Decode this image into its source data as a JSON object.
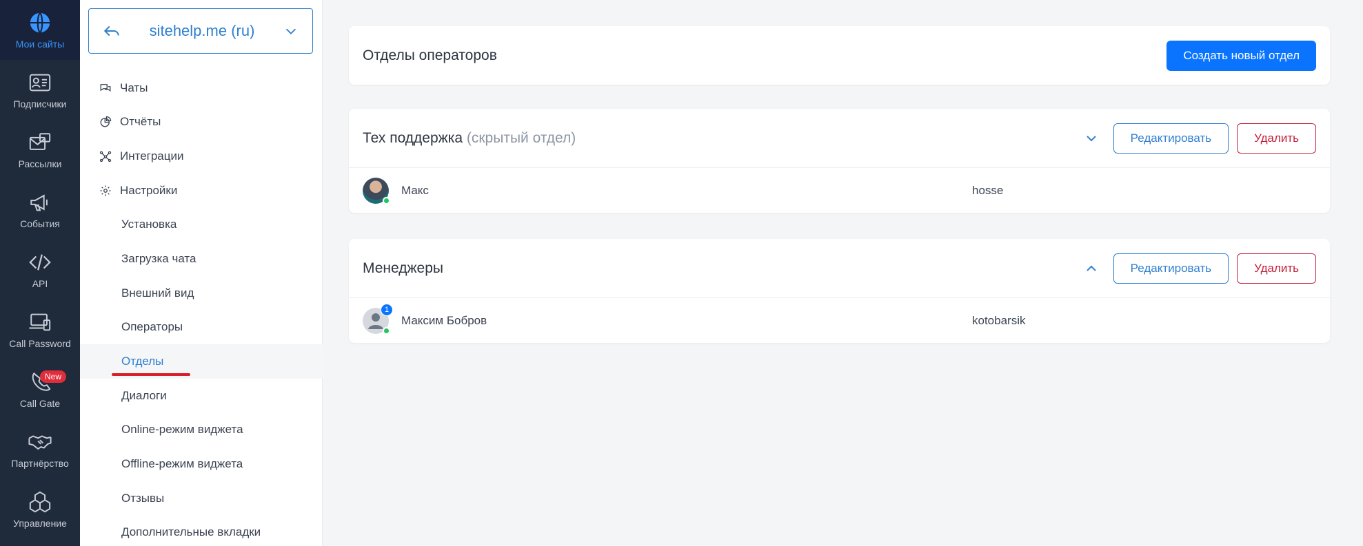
{
  "rail": [
    {
      "label": "Мои сайты",
      "icon": "globe-icon",
      "active": true
    },
    {
      "label": "Подписчики",
      "icon": "contact-card-icon"
    },
    {
      "label": "Рассылки",
      "icon": "mail-icon"
    },
    {
      "label": "События",
      "icon": "megaphone-icon"
    },
    {
      "label": "API",
      "icon": "code-icon"
    },
    {
      "label": "Call Password",
      "icon": "devices-icon"
    },
    {
      "label": "Call Gate",
      "icon": "phone-icon",
      "badge": "New"
    },
    {
      "label": "Партнёрство",
      "icon": "handshake-icon"
    },
    {
      "label": "Управление",
      "icon": "cubes-icon"
    }
  ],
  "site_selector": {
    "name": "sitehelp.me (ru)"
  },
  "nav": {
    "chats": "Чаты",
    "reports": "Отчёты",
    "integrations": "Интеграции",
    "settings": "Настройки",
    "install": "Установка",
    "chat_loading": "Загрузка чата",
    "appearance": "Внешний вид",
    "operators": "Операторы",
    "departments": "Отделы",
    "dialogs": "Диалоги",
    "online_mode": "Online-режим виджета",
    "offline_mode": "Offline-режим виджета",
    "reviews": "Отзывы",
    "extra_tabs": "Дополнительные вкладки"
  },
  "header": {
    "title": "Отделы операторов",
    "create_button": "Создать новый отдел"
  },
  "departments": [
    {
      "name": "Тех поддержка",
      "hidden_note": "(скрытый отдел)",
      "edit_label": "Редактировать",
      "delete_label": "Удалить",
      "operator_name": "Макс",
      "operator_login": "hosse"
    },
    {
      "name": "Менеджеры",
      "edit_label": "Редактировать",
      "delete_label": "Удалить",
      "operator_name": "Максим Бобров",
      "operator_login": "kotobarsik",
      "unread_count": "1"
    }
  ],
  "colors": {
    "accent": "#0a74ff",
    "rail_bg": "#1f2a3b",
    "danger": "#c2213a",
    "online": "#22c55e"
  }
}
